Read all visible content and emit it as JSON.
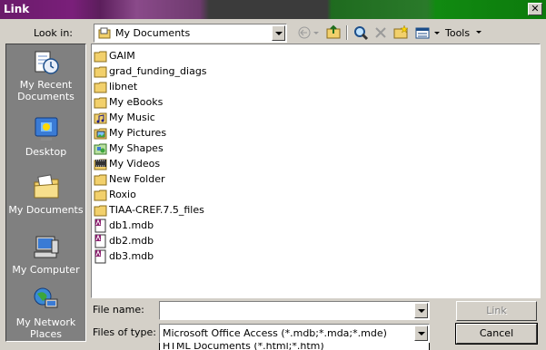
{
  "window": {
    "title": "Link"
  },
  "lookin": {
    "label": "Look in:",
    "value": "My Documents"
  },
  "toolbar": {
    "tools_label": "Tools"
  },
  "places": [
    {
      "label": "My Recent Documents",
      "icon": "recent-documents-icon"
    },
    {
      "label": "Desktop",
      "icon": "desktop-icon"
    },
    {
      "label": "My Documents",
      "icon": "my-documents-icon"
    },
    {
      "label": "My Computer",
      "icon": "my-computer-icon"
    },
    {
      "label": "My Network Places",
      "icon": "network-places-icon"
    }
  ],
  "files": [
    {
      "name": "GAIM",
      "icon": "folder-icon"
    },
    {
      "name": "grad_funding_diags",
      "icon": "folder-icon"
    },
    {
      "name": "libnet",
      "icon": "folder-icon"
    },
    {
      "name": "My eBooks",
      "icon": "folder-icon"
    },
    {
      "name": "My Music",
      "icon": "music-folder-icon"
    },
    {
      "name": "My Pictures",
      "icon": "pictures-folder-icon"
    },
    {
      "name": "My Shapes",
      "icon": "shapes-folder-icon"
    },
    {
      "name": "My Videos",
      "icon": "videos-folder-icon"
    },
    {
      "name": "New Folder",
      "icon": "folder-icon"
    },
    {
      "name": "Roxio",
      "icon": "folder-icon"
    },
    {
      "name": "TIAA-CREF.7.5_files",
      "icon": "folder-icon"
    },
    {
      "name": "db1.mdb",
      "icon": "access-db-icon"
    },
    {
      "name": "db2.mdb",
      "icon": "access-db-icon"
    },
    {
      "name": "db3.mdb",
      "icon": "access-db-icon"
    }
  ],
  "filename": {
    "label": "File name:",
    "value": ""
  },
  "filetype": {
    "label": "Files of type:",
    "value": "Microsoft Office Access (*.mdb;*.mda;*.mde)",
    "next_option": "HTML Documents (*.html;*.htm)"
  },
  "buttons": {
    "link": "Link",
    "cancel": "Cancel"
  }
}
